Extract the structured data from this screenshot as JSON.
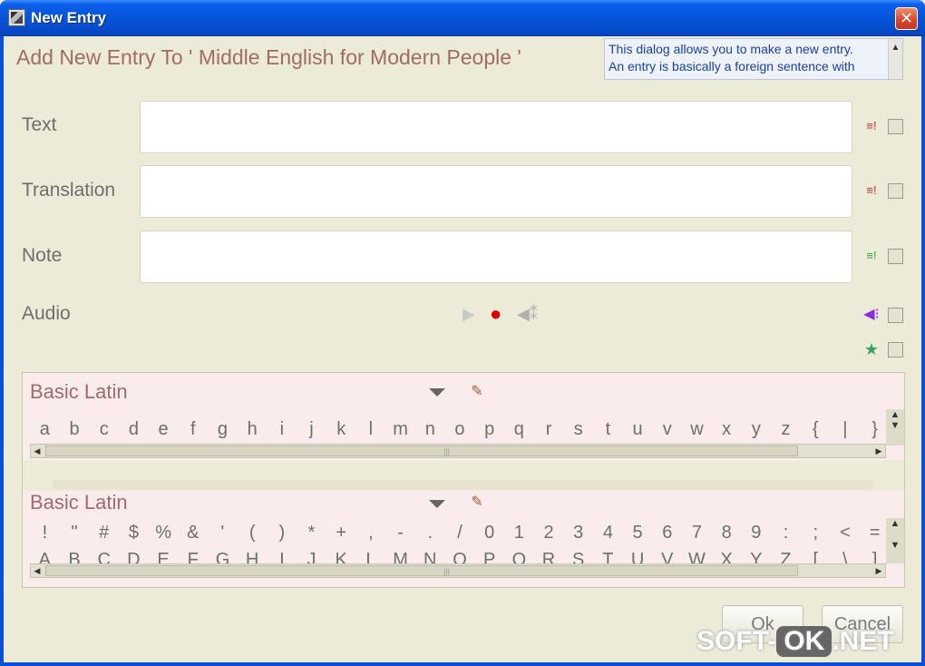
{
  "window": {
    "title": "New Entry",
    "close_glyph": "✕"
  },
  "header": {
    "title": "Add New Entry To ' Middle English for Modern People '",
    "help_line1": "This dialog allows you to make a new entry.",
    "help_line2": "An entry is basically a foreign sentence with"
  },
  "fields": {
    "text_label": "Text",
    "translation_label": "Translation",
    "note_label": "Note",
    "audio_label": "Audio"
  },
  "panels": [
    {
      "title": "Basic Latin",
      "row1": [
        "a",
        "b",
        "c",
        "d",
        "e",
        "f",
        "g",
        "h",
        "i",
        "j",
        "k",
        "l",
        "m",
        "n",
        "o",
        "p",
        "q",
        "r",
        "s",
        "t",
        "u",
        "v",
        "w",
        "x",
        "y",
        "z",
        "{",
        "|",
        "}",
        "~"
      ]
    },
    {
      "title": "Basic Latin",
      "row1": [
        "!",
        "\"",
        "#",
        "$",
        "%",
        "&",
        "'",
        "(",
        ")",
        "*",
        "+",
        ",",
        "-",
        ".",
        "/",
        "0",
        "1",
        "2",
        "3",
        "4",
        "5",
        "6",
        "7",
        "8",
        "9",
        ":",
        ";",
        "<",
        "=",
        ">"
      ],
      "row2": [
        "A",
        "B",
        "C",
        "D",
        "E",
        "F",
        "G",
        "H",
        "I",
        "J",
        "K",
        "L",
        "M",
        "N",
        "O",
        "P",
        "Q",
        "R",
        "S",
        "T",
        "U",
        "V",
        "W",
        "X",
        "Y",
        "Z",
        "[",
        "\\",
        "]",
        "^"
      ]
    }
  ],
  "buttons": {
    "ok": "Ok",
    "cancel": "Cancel"
  },
  "watermark": {
    "left": "SOFT-",
    "mid": "OK",
    "right": ".NET"
  },
  "colors": {
    "accent": "#A26A6A",
    "record": "#E00000",
    "audio_icon": "#8A2BE2",
    "star": "#3CA060"
  }
}
